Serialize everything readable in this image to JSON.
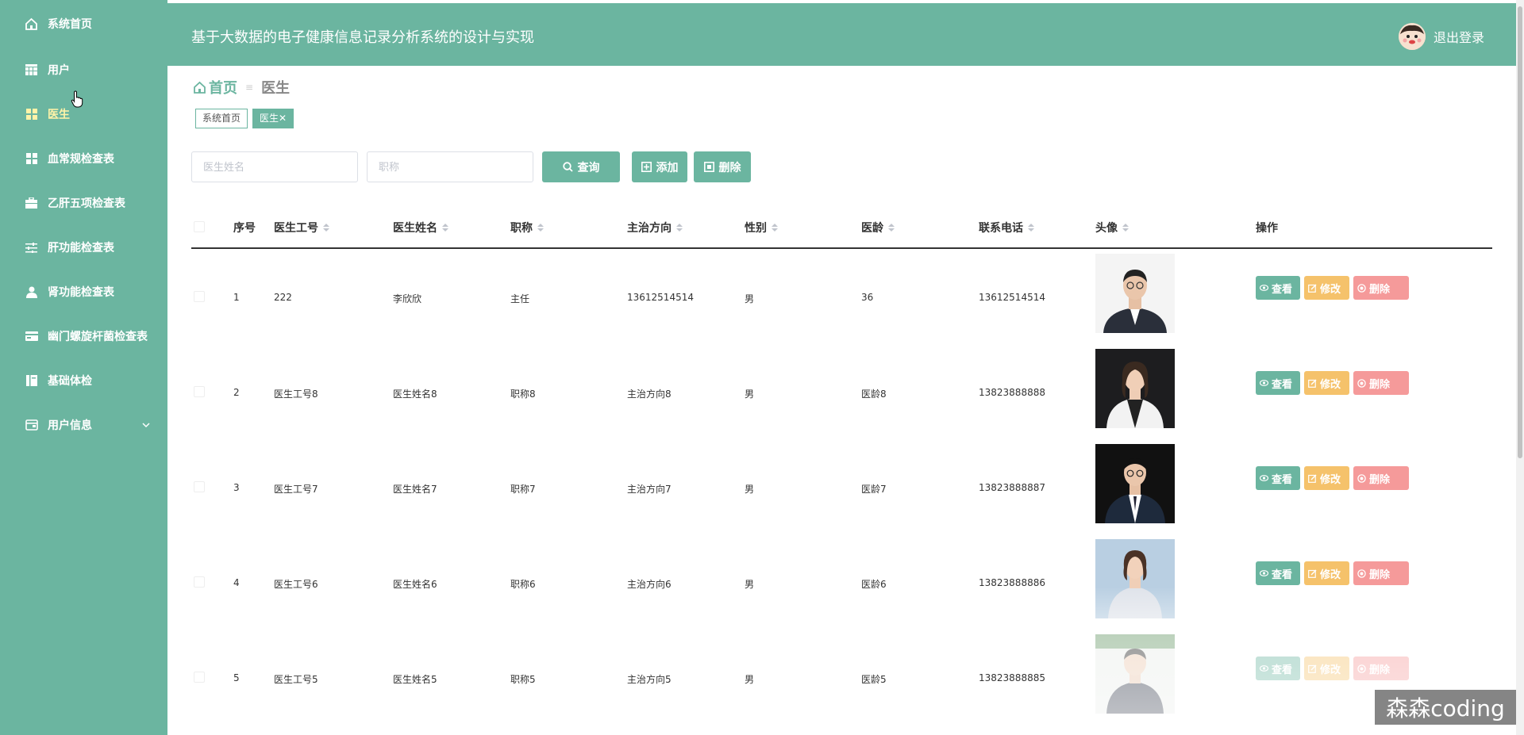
{
  "sidebar": {
    "items": [
      {
        "label": "系统首页",
        "icon": "home-icon"
      },
      {
        "label": "用户",
        "icon": "table-icon"
      },
      {
        "label": "医生",
        "icon": "grid-icon",
        "active": true
      },
      {
        "label": "血常规检查表",
        "icon": "grid-icon"
      },
      {
        "label": "乙肝五项检查表",
        "icon": "briefcase-icon"
      },
      {
        "label": "肝功能检查表",
        "icon": "sliders-icon"
      },
      {
        "label": "肾功能检查表",
        "icon": "user-icon"
      },
      {
        "label": "幽门螺旋杆菌检查表",
        "icon": "card-icon"
      },
      {
        "label": "基础体检",
        "icon": "book-icon"
      },
      {
        "label": "用户信息",
        "icon": "wallet-icon",
        "expandable": true
      }
    ]
  },
  "header": {
    "title": "基于大数据的电子健康信息记录分析系统的设计与实现",
    "logout_label": "退出登录"
  },
  "breadcrumb": {
    "home": "首页",
    "separator": "≡",
    "current": "医生"
  },
  "tags": [
    {
      "label": "系统首页"
    },
    {
      "label": "医生✕",
      "active": true
    }
  ],
  "search": {
    "name_placeholder": "医生姓名",
    "title_placeholder": "职称",
    "query_label": "查询",
    "add_label": "添加",
    "delete_label": "删除"
  },
  "table": {
    "headers": {
      "index": "序号",
      "doctor_id": "医生工号",
      "doctor_name": "医生姓名",
      "title": "职称",
      "specialty": "主治方向",
      "gender": "性别",
      "years": "医龄",
      "phone": "联系电话",
      "avatar": "头像",
      "actions": "操作"
    },
    "rows": [
      {
        "index": "1",
        "doctor_id": "222",
        "doctor_name": "李欣欣",
        "title": "主任",
        "specialty": "13612514514",
        "gender": "男",
        "years": "36",
        "phone": "13612514514"
      },
      {
        "index": "2",
        "doctor_id": "医生工号8",
        "doctor_name": "医生姓名8",
        "title": "职称8",
        "specialty": "主治方向8",
        "gender": "男",
        "years": "医龄8",
        "phone": "13823888888"
      },
      {
        "index": "3",
        "doctor_id": "医生工号7",
        "doctor_name": "医生姓名7",
        "title": "职称7",
        "specialty": "主治方向7",
        "gender": "男",
        "years": "医龄7",
        "phone": "13823888887"
      },
      {
        "index": "4",
        "doctor_id": "医生工号6",
        "doctor_name": "医生姓名6",
        "title": "职称6",
        "specialty": "主治方向6",
        "gender": "男",
        "years": "医龄6",
        "phone": "13823888886"
      },
      {
        "index": "5",
        "doctor_id": "医生工号5",
        "doctor_name": "医生姓名5",
        "title": "职称5",
        "specialty": "主治方向5",
        "gender": "男",
        "years": "医龄5",
        "phone": "13823888885"
      }
    ],
    "actions": {
      "view": "查看",
      "edit": "修改",
      "delete": "删除"
    }
  },
  "watermark": "森森coding",
  "colors": {
    "primary": "#6bb5a0",
    "active_text": "#fff3a8",
    "edit": "#f5c26b",
    "delete": "#f59a9a"
  }
}
